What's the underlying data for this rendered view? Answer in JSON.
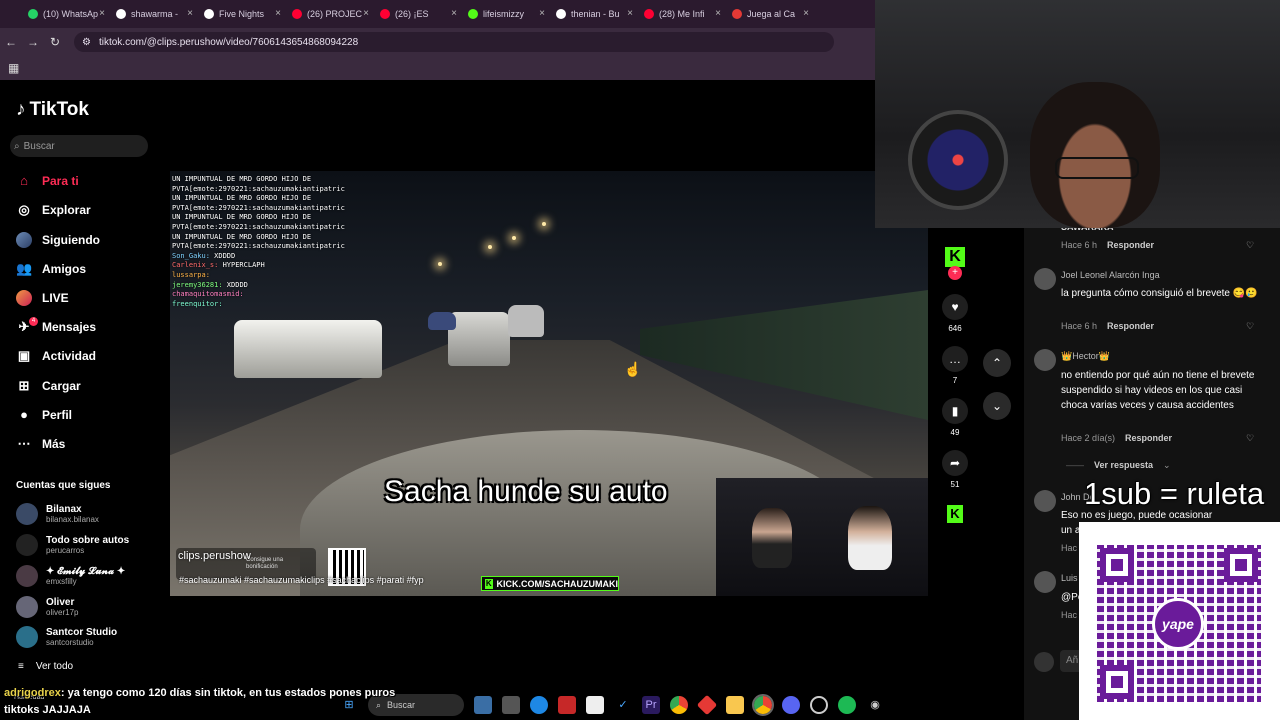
{
  "browser": {
    "tabs": [
      {
        "label": "(10) WhatsAp",
        "color": "#25d366"
      },
      {
        "label": "shawarma -",
        "color": "#ffffff"
      },
      {
        "label": "Five Nights",
        "color": "#ffffff"
      },
      {
        "label": "(26) PROJEC",
        "color": "#ff0033"
      },
      {
        "label": "(26) ¡ES",
        "color": "#ff0033"
      },
      {
        "label": "lifeismizzy",
        "color": "#53fc18"
      },
      {
        "label": "thenian - Bu",
        "color": "#ffffff"
      },
      {
        "label": "(28) Me Infi",
        "color": "#ff0033"
      },
      {
        "label": "Juega al Ca",
        "color": "#e53935"
      }
    ],
    "url": "tiktok.com/@clips.perushow/video/7606143654868094228"
  },
  "tiktok": {
    "logo": "TikTok",
    "search_placeholder": "Buscar",
    "nav": [
      {
        "label": "Para ti",
        "icon": "home-icon"
      },
      {
        "label": "Explorar",
        "icon": "compass-icon"
      },
      {
        "label": "Siguiendo",
        "icon": "following-icon"
      },
      {
        "label": "Amigos",
        "icon": "friends-icon"
      },
      {
        "label": "LIVE",
        "icon": "live-icon"
      },
      {
        "label": "Mensajes",
        "icon": "messages-icon",
        "badge": "4"
      },
      {
        "label": "Actividad",
        "icon": "activity-icon"
      },
      {
        "label": "Cargar",
        "icon": "upload-icon"
      },
      {
        "label": "Perfil",
        "icon": "profile-icon"
      },
      {
        "label": "Más",
        "icon": "more-icon"
      }
    ],
    "following_title": "Cuentas que sigues",
    "following": [
      {
        "name": "Bilanax",
        "handle": "bilanax.bilanax"
      },
      {
        "name": "Todo sobre autos",
        "handle": "perucarros"
      },
      {
        "name": "✦ 𝓔𝓶𝓲𝓵𝔂 𝓛𝓾𝓷𝓪 ✦",
        "handle": "emxsfilly"
      },
      {
        "name": "Oliver",
        "handle": "oliver17p"
      },
      {
        "name": "Santcor Studio",
        "handle": "santcorstudio"
      }
    ],
    "see_all": "Ver todo"
  },
  "video": {
    "chat_lines": [
      "UN IMPUNTUAL DE MRD GORDO HIJO DE",
      "PVTA[emote:2970221:sachauzumakiantipatric",
      "UN IMPUNTUAL DE MRD GORDO HIJO DE",
      "PVTA[emote:2970221:sachauzumakiantipatric",
      "UN IMPUNTUAL DE MRD GORDO HIJO DE",
      "PVTA[emote:2970221:sachauzumakiantipatric",
      "UN IMPUNTUAL DE MRD GORDO HIJO DE",
      "PVTA[emote:2970221:sachauzumakiantipatric"
    ],
    "chat_users": [
      {
        "user": "Son_Gaku:",
        "msg": "XDDDD"
      },
      {
        "user": "Carlenix_s:",
        "msg": "HYPERCLAPH"
      },
      {
        "user": "lussarpa:",
        "msg": ""
      },
      {
        "user": "jeremy36281:",
        "msg": "XDDDD"
      },
      {
        "user": "chamaquitomasmid:",
        "msg": ""
      },
      {
        "user": "freenquitor:",
        "msg": ""
      }
    ],
    "caption": "Sacha hunde su auto",
    "channel": "clips.perushow",
    "bonus_text": "Consigue una bonificación",
    "hashtags": "#sachauzumaki #sachauzumakiclips #sachaclips #parati #fyp",
    "kick_label": "KICK.COM/SACHAUZUMAKI"
  },
  "actions": {
    "likes": "646",
    "comments": "7",
    "saves": "49",
    "shares": "51"
  },
  "comments": [
    {
      "name": "SAWARAKA",
      "text": "",
      "time": "Hace 6 h",
      "reply": "Responder"
    },
    {
      "name": "Joel Leonel Alarcón Inga",
      "text": "la pregunta cómo consiguió el brevete 😋🥲",
      "time": "Hace 6 h",
      "reply": "Responder"
    },
    {
      "name": "👑Hector👑",
      "text": "no entiendo por qué aún no tiene el brevete suspendido si hay videos en los que casi choca varias veces y causa accidentes",
      "time": "Hace 2 día(s)",
      "reply": "Responder"
    },
    {
      "name": "John De",
      "text": "Eso no es juego, puede ocasionar un acc",
      "time": "Hac",
      "reply": ""
    },
    {
      "name": "Luis",
      "text": "@Pe",
      "time": "Hac",
      "reply": ""
    }
  ],
  "view_replies": "Ver respuesta",
  "add_comment": "Añ",
  "overlay": {
    "ruleta": "1sub = ruleta",
    "yape": "yape"
  },
  "stream_chat": {
    "user": "adrigodrex",
    "message": ": ya tengo como 120 días sin tiktok, en tus estados pones puros tiktoks JAJJAJA",
    "weather": "Humedad"
  },
  "taskbar": {
    "search": "Buscar"
  }
}
